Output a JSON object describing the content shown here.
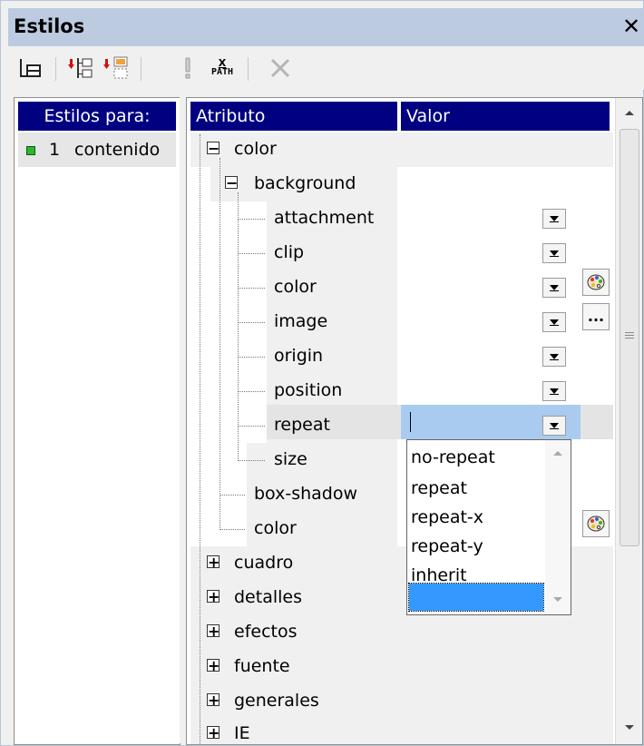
{
  "window": {
    "title": "Estilos",
    "close_glyph": "✕"
  },
  "toolbar": {
    "buttons": [
      "add-style-icon",
      "add-child-icon",
      "add-sibling-icon",
      "exclamation-icon",
      "xpath-icon",
      "delete-icon"
    ],
    "xpath_text_top": "X",
    "xpath_text_bottom": "PATH"
  },
  "left": {
    "header": "Estilos para:",
    "items": [
      {
        "number": "1",
        "label": "contenido"
      }
    ]
  },
  "table": {
    "col_attr": "Atributo",
    "col_value": "Valor",
    "rows": {
      "color_group": "color",
      "background": "background",
      "attachment": "attachment",
      "clip": "clip",
      "color": "color",
      "image": "image",
      "origin": "origin",
      "position": "position",
      "repeat": "repeat",
      "size": "size",
      "box_shadow": "box-shadow",
      "color2": "color",
      "cuadro": "cuadro",
      "detalles": "detalles",
      "efectos": "efectos",
      "fuente": "fuente",
      "generales": "generales",
      "ie": "IE"
    },
    "ellipsis": "..."
  },
  "dropdown": {
    "options": [
      "no-repeat",
      "repeat",
      "repeat-x",
      "repeat-y",
      "inherit"
    ]
  },
  "colors": {
    "header_bg": "#000080",
    "selection": "#3399ff",
    "titlebar": "#bccbe0"
  }
}
